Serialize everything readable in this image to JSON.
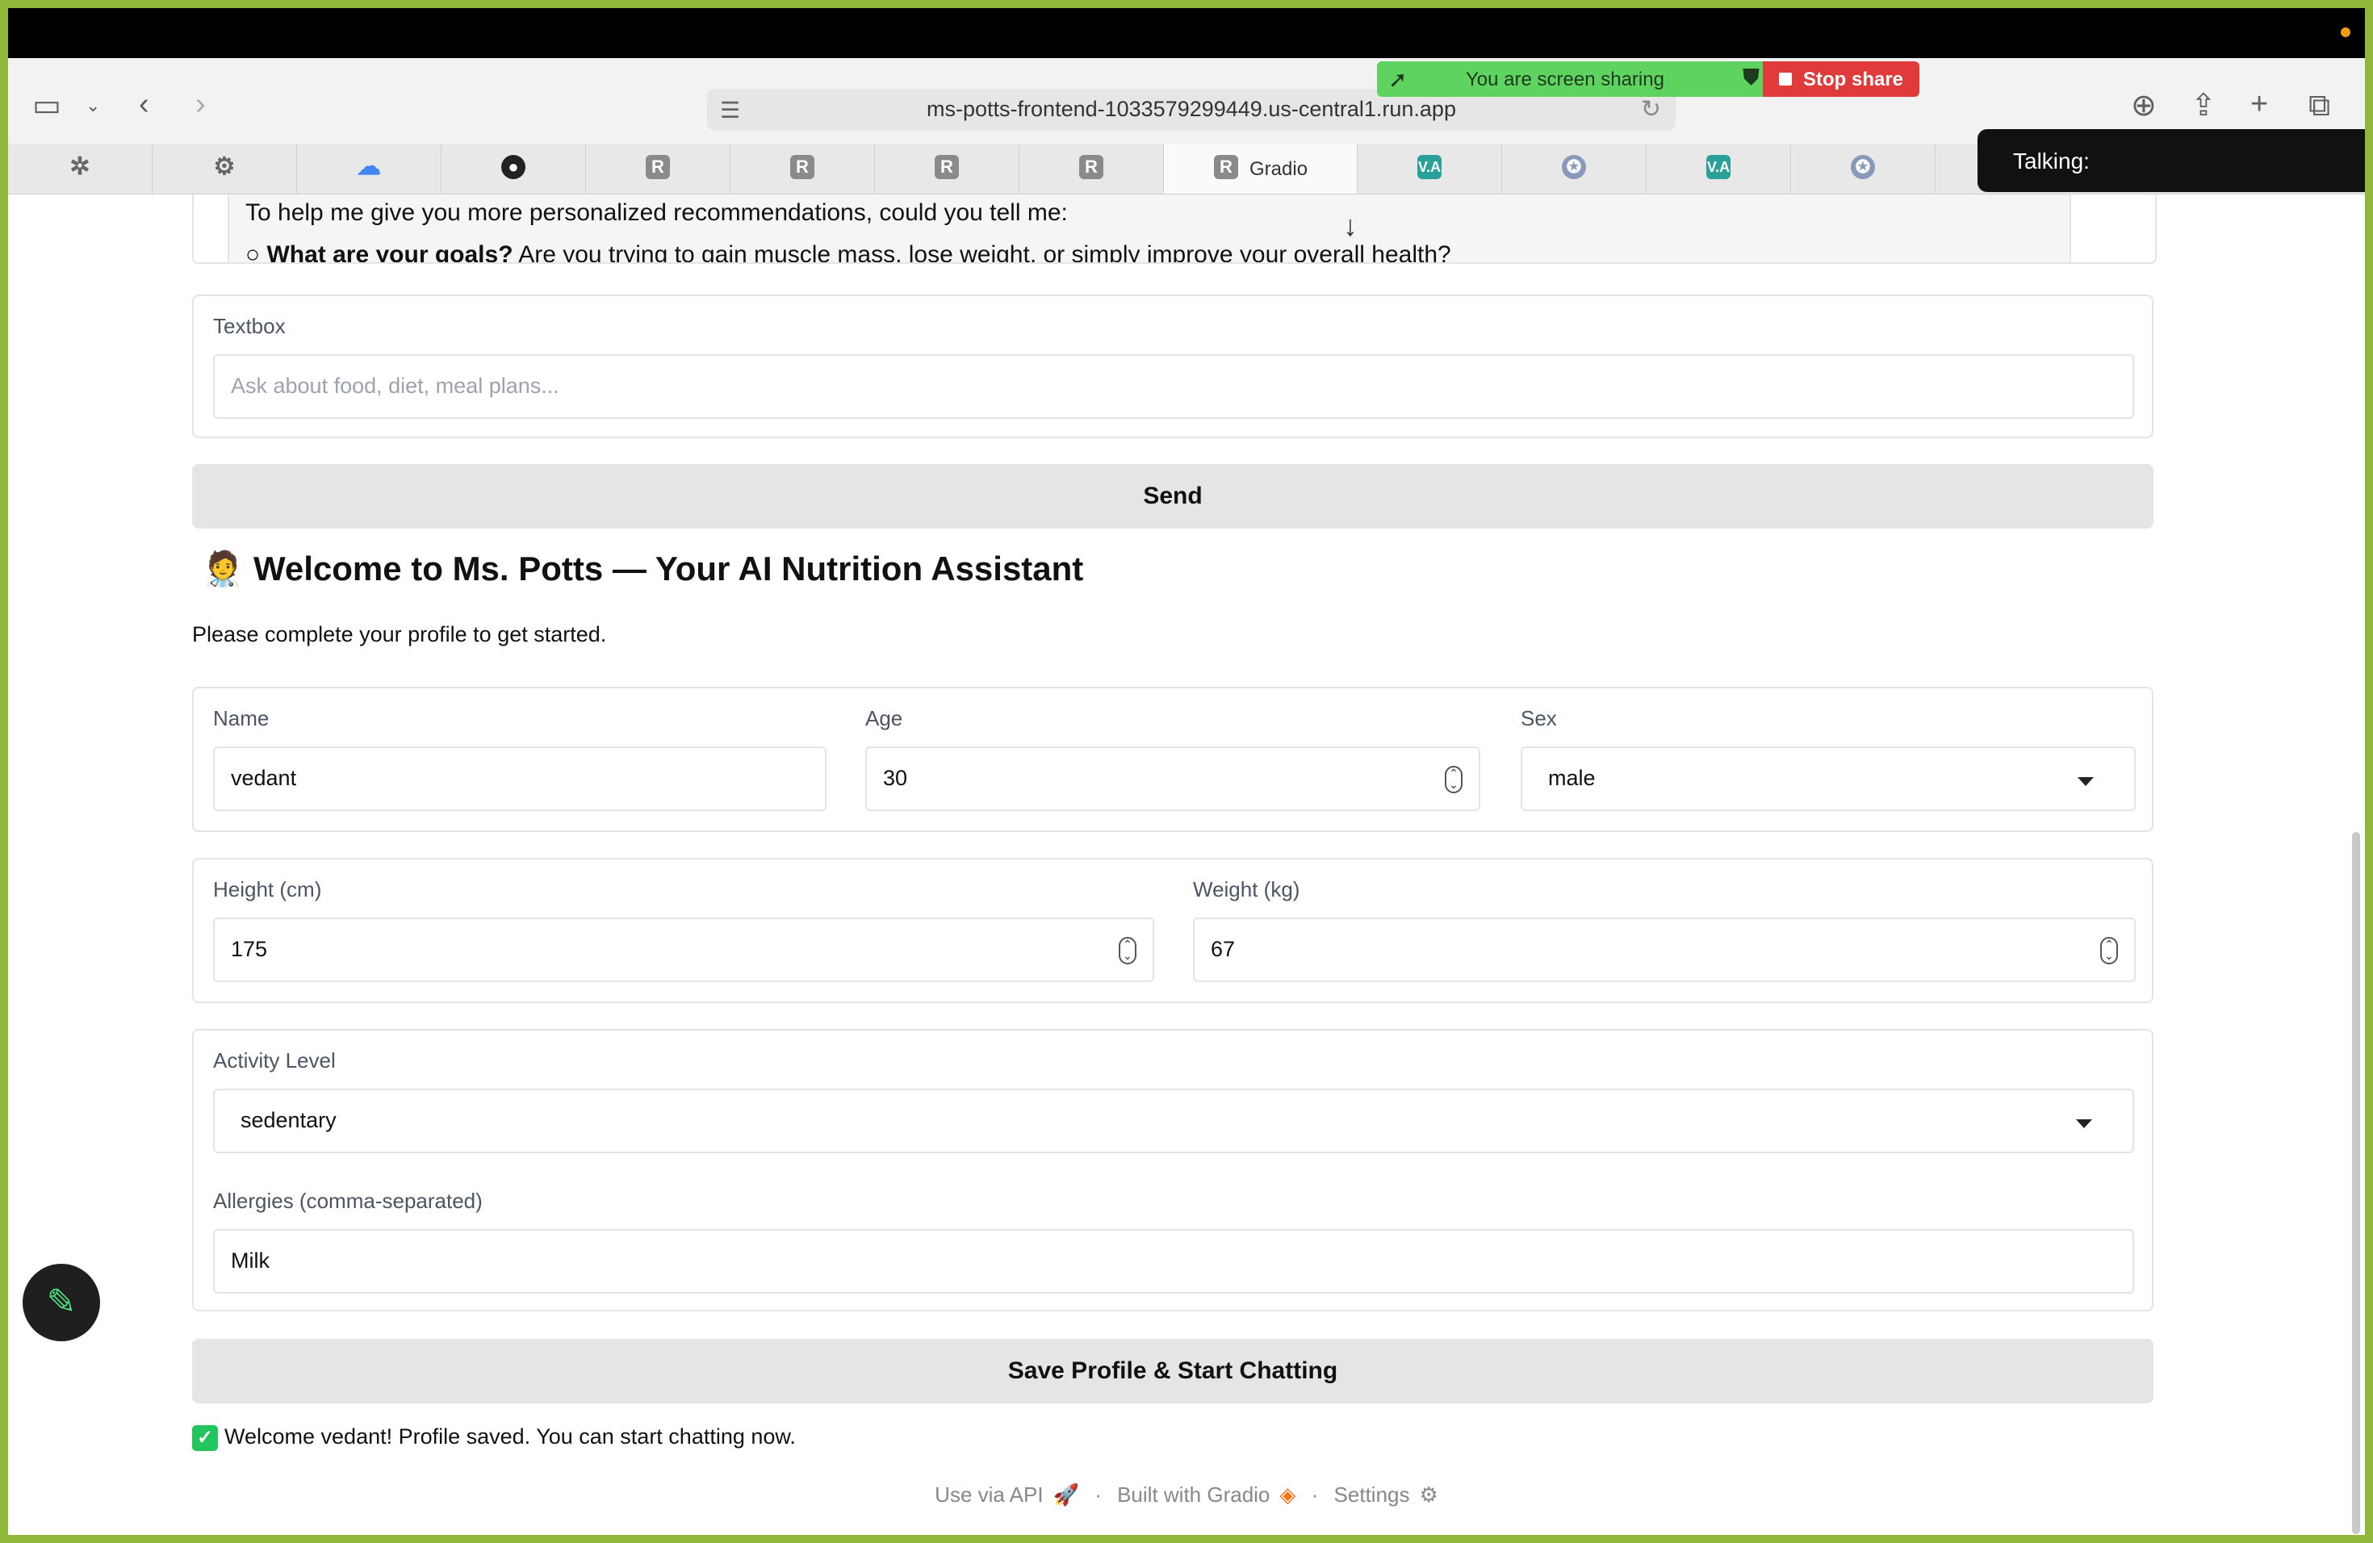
{
  "browser": {
    "url": "ms-potts-frontend-1033579299449.us-central1.run.app",
    "active_tab_label": "Gradio",
    "tabs": [
      {
        "icon": "puzzle-icon",
        "glyph": "✲"
      },
      {
        "icon": "gear-icon",
        "glyph": "⚙"
      },
      {
        "icon": "google-cloud-icon",
        "glyph": "☁"
      },
      {
        "icon": "github-icon",
        "glyph": "●"
      },
      {
        "icon": "r-icon",
        "glyph": "R"
      },
      {
        "icon": "r-icon",
        "glyph": "R"
      },
      {
        "icon": "r-icon",
        "glyph": "R"
      },
      {
        "icon": "r-icon",
        "glyph": "R"
      },
      {
        "icon": "r-icon",
        "glyph": "R"
      },
      {
        "icon": "va-icon",
        "glyph": "V.A"
      },
      {
        "icon": "seal-icon",
        "glyph": "✪"
      },
      {
        "icon": "va-icon",
        "glyph": "V.A"
      },
      {
        "icon": "seal-icon",
        "glyph": "✪"
      }
    ]
  },
  "screen_share": {
    "message": "You are screen sharing",
    "stop_label": "Stop share"
  },
  "talking_overlay": "Talking:",
  "chat": {
    "line1": "To help me give you more personalized recommendations, could you tell me:",
    "line2_bold": "What are your goals?",
    "line2_rest": " Are you trying to gain muscle mass, lose weight, or simply improve your overall health?"
  },
  "textbox": {
    "label": "Textbox",
    "placeholder": "Ask about food, diet, meal plans..."
  },
  "send_label": "Send",
  "heading": "🧑‍⚕️ Welcome to Ms. Potts — Your AI Nutrition Assistant",
  "subtext": "Please complete your profile to get started.",
  "profile": {
    "name_label": "Name",
    "name_value": "vedant",
    "age_label": "Age",
    "age_value": "30",
    "sex_label": "Sex",
    "sex_value": "male",
    "height_label": "Height (cm)",
    "height_value": "175",
    "weight_label": "Weight (kg)",
    "weight_value": "67",
    "activity_label": "Activity Level",
    "activity_value": "sedentary",
    "allergies_label": "Allergies (comma-separated)",
    "allergies_value": "Milk"
  },
  "save_label": "Save Profile & Start Chatting",
  "status_message": "Welcome vedant! Profile saved. You can start chatting now.",
  "footer": {
    "api": "Use via API",
    "built": "Built with Gradio",
    "settings": "Settings",
    "separator": "·"
  }
}
